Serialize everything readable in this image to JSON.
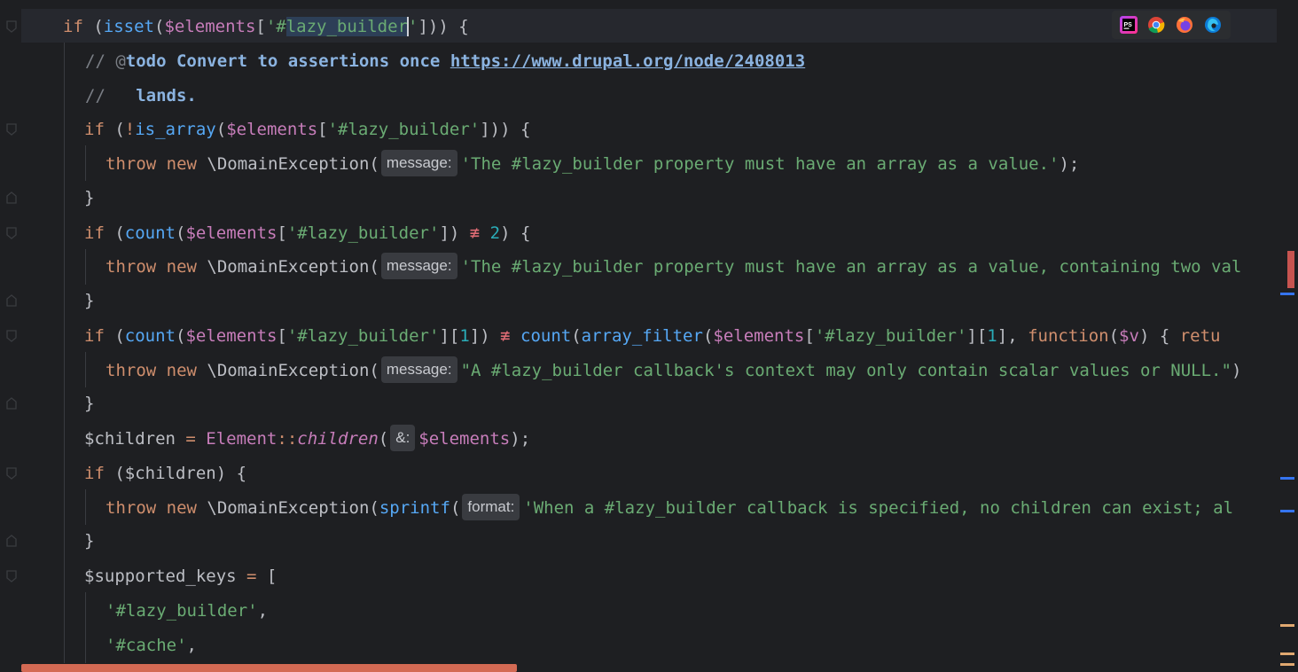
{
  "editor": {
    "lines": [
      {
        "id": "l1",
        "tokens": [
          [
            "kw",
            "if"
          ],
          [
            "plain",
            " ("
          ],
          [
            "fn",
            "isset"
          ],
          [
            "plain",
            "("
          ],
          [
            "var",
            "$elements"
          ],
          [
            "plain",
            "["
          ],
          [
            "str",
            "'#"
          ],
          [
            "hlstr",
            "lazy_builder"
          ],
          [
            "caret",
            ""
          ],
          [
            "str",
            "'"
          ],
          [
            "plain",
            "])) {"
          ]
        ]
      },
      {
        "id": "l2",
        "tokens": [
          [
            "cmt",
            "// @"
          ],
          [
            "tag",
            "todo Convert to assertions once "
          ],
          [
            "link",
            "https://www.drupal.org/node/2408013"
          ]
        ]
      },
      {
        "id": "l3",
        "tokens": [
          [
            "cmt",
            "//   "
          ],
          [
            "tag",
            "lands."
          ]
        ]
      },
      {
        "id": "l4",
        "tokens": [
          [
            "kw",
            "if"
          ],
          [
            "plain",
            " ("
          ],
          [
            "kw",
            "!"
          ],
          [
            "fn",
            "is_array"
          ],
          [
            "plain",
            "("
          ],
          [
            "var",
            "$elements"
          ],
          [
            "plain",
            "["
          ],
          [
            "str",
            "'#lazy_builder'"
          ],
          [
            "plain",
            "])) {"
          ]
        ]
      },
      {
        "id": "l5",
        "tokens": [
          [
            "kw",
            "throw new "
          ],
          [
            "plain",
            "\\DomainException("
          ],
          [
            "hint",
            "message:"
          ],
          [
            "str",
            "'The #lazy_builder property must have an array as a value.'"
          ],
          [
            "plain",
            ");"
          ]
        ]
      },
      {
        "id": "l6",
        "tokens": [
          [
            "plain",
            "}"
          ]
        ]
      },
      {
        "id": "l7",
        "tokens": [
          [
            "kw",
            "if"
          ],
          [
            "plain",
            " ("
          ],
          [
            "fn",
            "count"
          ],
          [
            "plain",
            "("
          ],
          [
            "var",
            "$elements"
          ],
          [
            "plain",
            "["
          ],
          [
            "str",
            "'#lazy_builder'"
          ],
          [
            "plain",
            "]) "
          ],
          [
            "neq",
            "≢"
          ],
          [
            "plain",
            " "
          ],
          [
            "num",
            "2"
          ],
          [
            "plain",
            ") {"
          ]
        ]
      },
      {
        "id": "l8",
        "tokens": [
          [
            "kw",
            "throw new "
          ],
          [
            "plain",
            "\\DomainException("
          ],
          [
            "hint",
            "message:"
          ],
          [
            "str",
            "'The #lazy_builder property must have an array as a value, containing two val"
          ]
        ]
      },
      {
        "id": "l9",
        "tokens": [
          [
            "plain",
            "}"
          ]
        ]
      },
      {
        "id": "l10",
        "tokens": [
          [
            "kw",
            "if"
          ],
          [
            "plain",
            " ("
          ],
          [
            "fn",
            "count"
          ],
          [
            "plain",
            "("
          ],
          [
            "var",
            "$elements"
          ],
          [
            "plain",
            "["
          ],
          [
            "str",
            "'#lazy_builder'"
          ],
          [
            "plain",
            "]["
          ],
          [
            "num",
            "1"
          ],
          [
            "plain",
            "]) "
          ],
          [
            "neq",
            "≢"
          ],
          [
            "plain",
            " "
          ],
          [
            "fn",
            "count"
          ],
          [
            "plain",
            "("
          ],
          [
            "fn",
            "array_filter"
          ],
          [
            "plain",
            "("
          ],
          [
            "var",
            "$elements"
          ],
          [
            "plain",
            "["
          ],
          [
            "str",
            "'#lazy_builder'"
          ],
          [
            "plain",
            "]["
          ],
          [
            "num",
            "1"
          ],
          [
            "plain",
            "], "
          ],
          [
            "kw",
            "function"
          ],
          [
            "plain",
            "("
          ],
          [
            "var",
            "$v"
          ],
          [
            "plain",
            ") { "
          ],
          [
            "kw",
            "retu"
          ]
        ]
      },
      {
        "id": "l11",
        "tokens": [
          [
            "kw",
            "throw new "
          ],
          [
            "plain",
            "\\DomainException("
          ],
          [
            "hint",
            "message:"
          ],
          [
            "str",
            "\"A #lazy_builder callback's context may only contain scalar values or NULL.\""
          ],
          [
            "plain",
            ")"
          ]
        ]
      },
      {
        "id": "l12",
        "tokens": [
          [
            "plain",
            "}"
          ]
        ]
      },
      {
        "id": "l13",
        "tokens": [
          [
            "plain",
            "$children "
          ],
          [
            "kw",
            "="
          ],
          [
            "plain",
            " "
          ],
          [
            "var",
            "Element"
          ],
          [
            "kw",
            "::"
          ],
          [
            "stat",
            "children"
          ],
          [
            "plain",
            "("
          ],
          [
            "hint",
            "&:"
          ],
          [
            "var",
            "$elements"
          ],
          [
            "plain",
            ");"
          ]
        ]
      },
      {
        "id": "l14",
        "tokens": [
          [
            "kw",
            "if"
          ],
          [
            "plain",
            " ($children) {"
          ]
        ]
      },
      {
        "id": "l15",
        "tokens": [
          [
            "kw",
            "throw new "
          ],
          [
            "plain",
            "\\DomainException("
          ],
          [
            "fn",
            "sprintf"
          ],
          [
            "plain",
            "("
          ],
          [
            "hint",
            "format:"
          ],
          [
            "str",
            "'When a #lazy_builder callback is specified, no children can exist; al"
          ]
        ]
      },
      {
        "id": "l16",
        "tokens": [
          [
            "plain",
            "}"
          ]
        ]
      },
      {
        "id": "l17",
        "tokens": [
          [
            "plain",
            "$supported_keys "
          ],
          [
            "kw",
            "="
          ],
          [
            "plain",
            " ["
          ]
        ]
      },
      {
        "id": "l18",
        "tokens": [
          [
            "str",
            "'#lazy_builder'"
          ],
          [
            "plain",
            ","
          ]
        ]
      },
      {
        "id": "l19",
        "tokens": [
          [
            "str",
            "'#cache'"
          ],
          [
            "plain",
            ","
          ]
        ]
      }
    ]
  },
  "browser_icons": [
    "phpstorm-icon",
    "chrome-icon",
    "firefox-icon",
    "edge-icon"
  ],
  "browser_labels": {
    "phpstorm": "PS"
  },
  "colors": {
    "background": "#1e1f22",
    "keyword": "#cf8e6d",
    "function": "#56a8f5",
    "variable": "#c77dba",
    "string": "#6aab73",
    "number": "#2aacb8",
    "comment": "#7a7e85"
  }
}
